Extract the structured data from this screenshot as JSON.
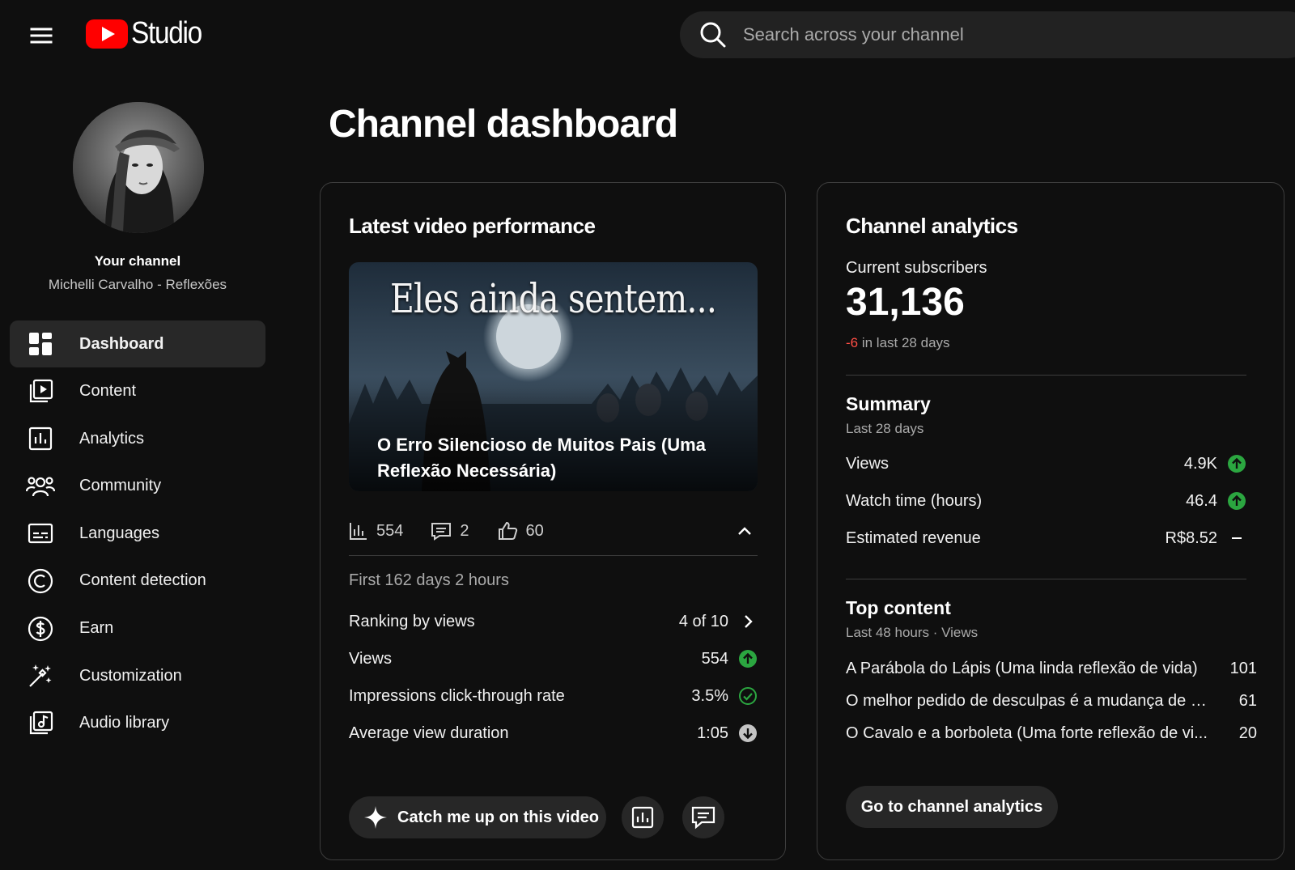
{
  "header": {
    "logo_text": "Studio",
    "search_placeholder": "Search across your channel"
  },
  "sidebar": {
    "channel_title": "Your channel",
    "channel_name": "Michelli Carvalho - Reflexões",
    "items": [
      {
        "label": "Dashboard",
        "icon": "dashboard-icon",
        "active": true
      },
      {
        "label": "Content",
        "icon": "content-icon"
      },
      {
        "label": "Analytics",
        "icon": "analytics-icon"
      },
      {
        "label": "Community",
        "icon": "community-icon"
      },
      {
        "label": "Languages",
        "icon": "languages-icon"
      },
      {
        "label": "Content detection",
        "icon": "copyright-icon"
      },
      {
        "label": "Earn",
        "icon": "dollar-icon"
      },
      {
        "label": "Customization",
        "icon": "magic-wand-icon"
      },
      {
        "label": "Audio library",
        "icon": "audio-library-icon"
      }
    ]
  },
  "main": {
    "page_title": "Channel dashboard"
  },
  "latest_video": {
    "card_title": "Latest video performance",
    "thumbnail_text": "Eles ainda sentem...",
    "video_title": "O Erro Silencioso de Muitos Pais (Uma Reflexão Necessária)",
    "views_count": "554",
    "comments_count": "2",
    "likes_count": "60",
    "period": "First 162 days 2 hours",
    "metrics": [
      {
        "label": "Ranking by views",
        "value": "4 of 10",
        "indicator": "chevron-right"
      },
      {
        "label": "Views",
        "value": "554",
        "indicator": "up-green"
      },
      {
        "label": "Impressions click-through rate",
        "value": "3.5%",
        "indicator": "check-green"
      },
      {
        "label": "Average view duration",
        "value": "1:05",
        "indicator": "down-gray"
      }
    ],
    "catch_up_label": "Catch me up on this video"
  },
  "channel_analytics": {
    "card_title": "Channel analytics",
    "subscribers_label": "Current subscribers",
    "subscribers_count": "31,136",
    "subscribers_change": "-6",
    "subscribers_change_suffix": " in last 28 days",
    "summary_title": "Summary",
    "summary_period": "Last 28 days",
    "summary": [
      {
        "label": "Views",
        "value": "4.9K",
        "indicator": "up-green"
      },
      {
        "label": "Watch time (hours)",
        "value": "46.4",
        "indicator": "up-green"
      },
      {
        "label": "Estimated revenue",
        "value": "R$8.52",
        "indicator": "dash"
      }
    ],
    "top_title": "Top content",
    "top_period": "Last 48 hours · Views",
    "top_content": [
      {
        "title": "A Parábola do Lápis (Uma linda reflexão de vida)",
        "views": "101"
      },
      {
        "title": "O melhor pedido de desculpas é a mudança de c...",
        "views": "61"
      },
      {
        "title": "O Cavalo e a borboleta (Uma forte reflexão de vi...",
        "views": "20"
      }
    ],
    "go_button": "Go to channel analytics"
  },
  "colors": {
    "background": "#0f0f0f",
    "accent_red": "#ff0000",
    "up_green": "#2ba640",
    "negative_red": "#ff4e45"
  }
}
